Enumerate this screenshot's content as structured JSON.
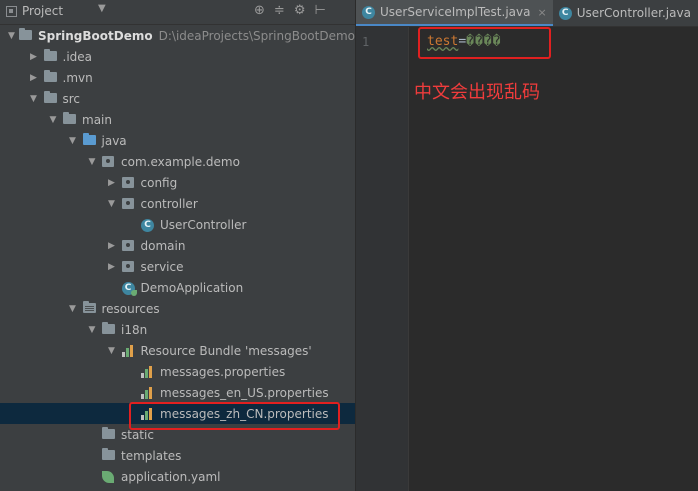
{
  "project_panel": {
    "title": "Project",
    "dropdown_glyph": "▼",
    "tool_glyphs": [
      "⊕",
      "≑",
      "⚙",
      "⊢"
    ],
    "tree": [
      {
        "label": "SpringBootDemo",
        "path": "D:\\ideaProjects\\SpringBootDemo",
        "icon": "folder-icon",
        "expanded": true,
        "indent": 0
      },
      {
        "label": ".idea",
        "icon": "folder-icon",
        "expanded": false,
        "indent": 1
      },
      {
        "label": ".mvn",
        "icon": "folder-icon",
        "expanded": false,
        "indent": 1
      },
      {
        "label": "src",
        "icon": "folder-icon",
        "expanded": true,
        "indent": 1
      },
      {
        "label": "main",
        "icon": "folder-icon",
        "expanded": true,
        "indent": 2
      },
      {
        "label": "java",
        "icon": "source-folder-icon",
        "expanded": true,
        "indent": 3
      },
      {
        "label": "com.example.demo",
        "icon": "package-icon",
        "expanded": true,
        "indent": 4
      },
      {
        "label": "config",
        "icon": "package-icon",
        "expanded": false,
        "indent": 5
      },
      {
        "label": "controller",
        "icon": "package-icon",
        "expanded": true,
        "indent": 5
      },
      {
        "label": "UserController",
        "icon": "class-icon",
        "expanded": null,
        "indent": 6
      },
      {
        "label": "domain",
        "icon": "package-icon",
        "expanded": false,
        "indent": 5
      },
      {
        "label": "service",
        "icon": "package-icon",
        "expanded": false,
        "indent": 5
      },
      {
        "label": "DemoApplication",
        "icon": "spring-class-icon",
        "expanded": null,
        "indent": 5
      },
      {
        "label": "resources",
        "icon": "resources-folder-icon",
        "expanded": true,
        "indent": 3
      },
      {
        "label": "i18n",
        "icon": "folder-icon",
        "expanded": true,
        "indent": 4
      },
      {
        "label": "Resource Bundle 'messages'",
        "icon": "resource-bundle-icon",
        "expanded": true,
        "indent": 5
      },
      {
        "label": "messages.properties",
        "icon": "properties-icon",
        "expanded": null,
        "indent": 6
      },
      {
        "label": "messages_en_US.properties",
        "icon": "properties-icon",
        "expanded": null,
        "indent": 6
      },
      {
        "label": "messages_zh_CN.properties",
        "icon": "properties-icon",
        "expanded": null,
        "indent": 6,
        "selected": true
      },
      {
        "label": "static",
        "icon": "folder-icon",
        "expanded": null,
        "indent": 4
      },
      {
        "label": "templates",
        "icon": "folder-icon",
        "expanded": null,
        "indent": 4
      },
      {
        "label": "application.yaml",
        "icon": "yaml-icon",
        "expanded": null,
        "indent": 4
      }
    ]
  },
  "editor": {
    "tabs": [
      {
        "label": "UserServiceImplTest.java",
        "active": true,
        "close": "×"
      },
      {
        "label": "UserController.java",
        "active": false
      }
    ],
    "line_number": "1",
    "code": {
      "key": "test",
      "eq": "=",
      "value": "����"
    }
  },
  "annotation": "中文会出现乱码",
  "colors": {
    "annotation": "#e02020",
    "selection": "#0d293e",
    "tab_accent": "#4a88c7"
  }
}
